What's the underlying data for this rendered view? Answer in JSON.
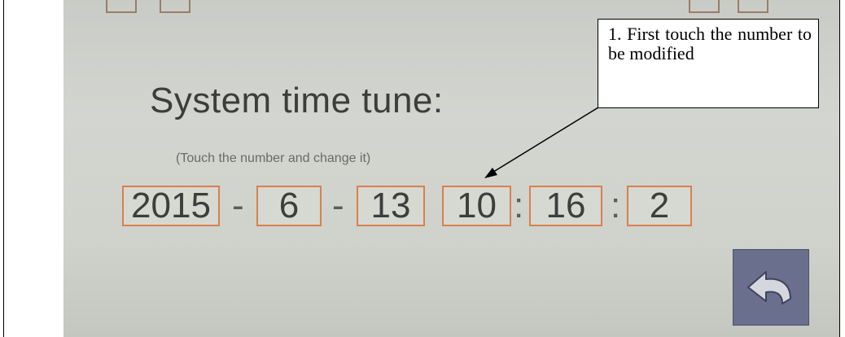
{
  "screen": {
    "title": "System time tune:",
    "subtitle": "(Touch the number and change it)",
    "fields": {
      "year": "2015",
      "month": "6",
      "day": "13",
      "hour": "10",
      "minute": "16",
      "second": "2"
    },
    "separators": {
      "date": "-",
      "time": ":"
    },
    "back_button_icon": "back-arrow-icon",
    "colors": {
      "field_border": "#d9804e",
      "back_button": "#6b6f8e"
    }
  },
  "annotation": {
    "callout_text": "1. First touch the number to be modified"
  }
}
